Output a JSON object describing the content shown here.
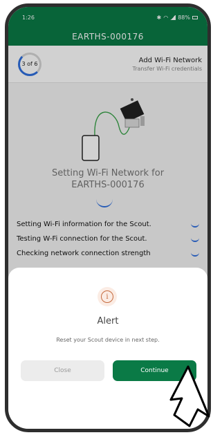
{
  "status_bar": {
    "time": "1:26",
    "battery": "88%"
  },
  "header": {
    "title": "EARTHS-000176"
  },
  "step": {
    "counter": "3 of 6",
    "title": "Add Wi-Fi Network",
    "subtitle": "Transfer Wi-Fi credentials"
  },
  "setting": {
    "title_line1": "Setting Wi-Fi Network for",
    "title_line2": "EARTHS-000176"
  },
  "checks": [
    {
      "label": "Setting Wi-Fi information for the Scout."
    },
    {
      "label": "Testing W-Fi connection for the Scout."
    },
    {
      "label": "Checking network connection strength"
    }
  ],
  "alert": {
    "icon": "info-icon",
    "title": "Alert",
    "message": "Reset your Scout device in next step.",
    "close_label": "Close",
    "continue_label": "Continue"
  },
  "colors": {
    "brand_green": "#0a7a46",
    "progress_blue": "#2f6fde",
    "alert_accent": "#c56a3d"
  }
}
